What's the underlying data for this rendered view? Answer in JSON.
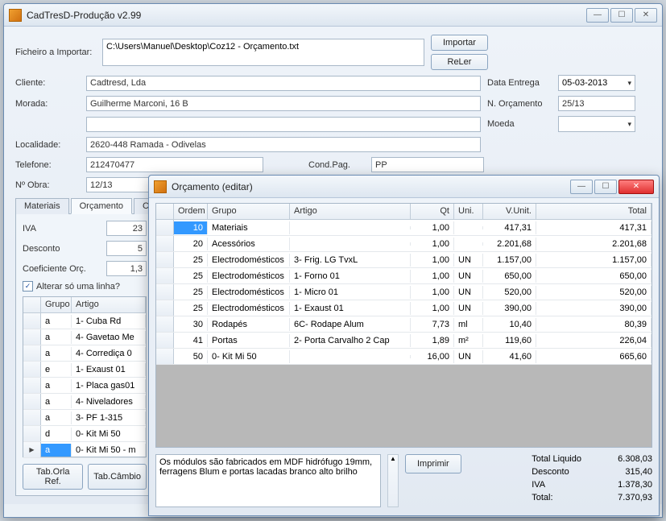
{
  "main_window": {
    "title": "CadTresD-Produção v2.99",
    "file_import_label": "Ficheiro a Importar:",
    "file_import_value": "C:\\Users\\Manuel\\Desktop\\Coz12 - Orçamento.txt",
    "btn_import": "Importar",
    "btn_reler": "ReLer",
    "cliente_label": "Cliente:",
    "cliente_value": "Cadtresd, Lda",
    "morada_label": "Morada:",
    "morada_value": "Guilherme Marconi, 16 B",
    "localidade_label": "Localidade:",
    "localidade_value": "2620-448 Ramada - Odivelas",
    "telefone_label": "Telefone:",
    "telefone_value": "212470477",
    "condpag_label": "Cond.Pag.",
    "condpag_value": "PP",
    "nobra_label": "Nº Obra:",
    "nobra_value": "12/13",
    "data_entrega_label": "Data Entrega",
    "data_entrega_value": "05-03-2013",
    "n_orcamento_label": "N. Orçamento",
    "n_orcamento_value": "25/13",
    "moeda_label": "Moeda",
    "moeda_value": "",
    "tabs": {
      "materiais": "Materiais",
      "orcamento": "Orçamento",
      "compor": "Compor"
    },
    "iva_label": "IVA",
    "iva_value": "23",
    "desconto_label": "Desconto",
    "desconto_value": "5",
    "coef_label": "Coeficiente Orç.",
    "coef_value": "1,3",
    "alterar_label": "Alterar só uma linha?",
    "left_grid": {
      "headers": {
        "grupo": "Grupo",
        "artigo": "Artigo"
      },
      "rows": [
        {
          "grupo": "a",
          "artigo": "1- Cuba Rd"
        },
        {
          "grupo": "a",
          "artigo": "4- Gavetao Me"
        },
        {
          "grupo": "a",
          "artigo": "4- Corrediça 0"
        },
        {
          "grupo": "e",
          "artigo": "1- Exaust 01"
        },
        {
          "grupo": "a",
          "artigo": "1- Placa gas01"
        },
        {
          "grupo": "a",
          "artigo": "4- Niveladores"
        },
        {
          "grupo": "a",
          "artigo": "3- PF 1-315"
        },
        {
          "grupo": "d",
          "artigo": "0- Kit Mi 50"
        },
        {
          "grupo": "a",
          "artigo": "0- Kit Mi 50 - m"
        }
      ]
    },
    "btn_orla": "Tab.Orla Ref.",
    "btn_cambio": "Tab.Câmbio"
  },
  "orc_window": {
    "title": "Orçamento (editar)",
    "headers": {
      "ordem": "Ordem",
      "grupo": "Grupo",
      "artigo": "Artigo",
      "qt": "Qt",
      "uni": "Uni.",
      "vunit": "V.Unit.",
      "total": "Total"
    },
    "rows": [
      {
        "ordem": "10",
        "grupo": "Materiais",
        "artigo": "",
        "qt": "1,00",
        "uni": "",
        "vunit": "417,31",
        "total": "417,31",
        "selected": true
      },
      {
        "ordem": "20",
        "grupo": "Acessórios",
        "artigo": "",
        "qt": "1,00",
        "uni": "",
        "vunit": "2.201,68",
        "total": "2.201,68"
      },
      {
        "ordem": "25",
        "grupo": "Electrodomésticos",
        "artigo": "3- Frig. LG TvxL",
        "qt": "1,00",
        "uni": "UN",
        "vunit": "1.157,00",
        "total": "1.157,00"
      },
      {
        "ordem": "25",
        "grupo": "Electrodomésticos",
        "artigo": "1- Forno 01",
        "qt": "1,00",
        "uni": "UN",
        "vunit": "650,00",
        "total": "650,00"
      },
      {
        "ordem": "25",
        "grupo": "Electrodomésticos",
        "artigo": "1- Micro 01",
        "qt": "1,00",
        "uni": "UN",
        "vunit": "520,00",
        "total": "520,00"
      },
      {
        "ordem": "25",
        "grupo": "Electrodomésticos",
        "artigo": "1- Exaust 01",
        "qt": "1,00",
        "uni": "UN",
        "vunit": "390,00",
        "total": "390,00"
      },
      {
        "ordem": "30",
        "grupo": "Rodapés",
        "artigo": "6C- Rodape Alum",
        "qt": "7,73",
        "uni": "ml",
        "vunit": "10,40",
        "total": "80,39"
      },
      {
        "ordem": "41",
        "grupo": "Portas",
        "artigo": "2- Porta Carvalho 2 Cap",
        "qt": "1,89",
        "uni": "m²",
        "vunit": "119,60",
        "total": "226,04"
      },
      {
        "ordem": "50",
        "grupo": "0- Kit Mi 50",
        "artigo": "",
        "qt": "16,00",
        "uni": "UN",
        "vunit": "41,60",
        "total": "665,60"
      }
    ],
    "notes": "Os módulos são fabricados em MDF hidrófugo 19mm, ferragens Blum e portas lacadas branco alto brilho",
    "btn_print": "Imprimir",
    "totals": {
      "liquido_label": "Total Liquido",
      "liquido_value": "6.308,03",
      "desconto_label": "Desconto",
      "desconto_value": "315,40",
      "iva_label": "IVA",
      "iva_value": "1.378,30",
      "total_label": "Total:",
      "total_value": "7.370,93"
    }
  }
}
